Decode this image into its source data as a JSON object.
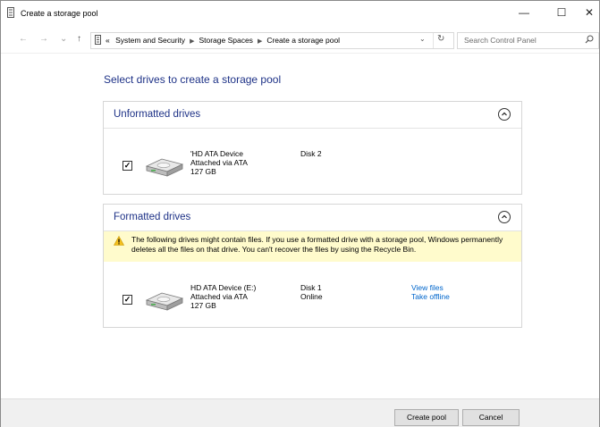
{
  "window": {
    "title": "Create a storage pool"
  },
  "titlebar": {
    "minimize": "—",
    "maximize": "☐",
    "close": "✕"
  },
  "nav": {
    "back": "←",
    "forward": "→",
    "recent": "⌄",
    "up": "↑",
    "breadcrumb": {
      "prefix": "«",
      "items": [
        "System and Security",
        "Storage Spaces",
        "Create a storage pool"
      ]
    },
    "dropdown": "⌄",
    "refresh": "↻"
  },
  "search": {
    "placeholder": "Search Control Panel"
  },
  "page": {
    "heading": "Select drives to create a storage pool"
  },
  "unformatted": {
    "title": "Unformatted drives",
    "drives": [
      {
        "name": "'HD ATA Device",
        "attached": "Attached via ATA",
        "size": "127 GB",
        "disk": "Disk 2",
        "checked": true
      }
    ]
  },
  "formatted": {
    "title": "Formatted drives",
    "warning": "The following drives might contain files. If you use a formatted drive with a storage pool, Windows permanently deletes all the files on that drive. You can't recover the files by using the Recycle Bin.",
    "drives": [
      {
        "name": "HD ATA Device (E:)",
        "attached": "Attached via ATA",
        "size": "127 GB",
        "disk": "Disk 1",
        "status": "Online",
        "link1": "View files",
        "link2": "Take offline",
        "checked": true
      }
    ]
  },
  "footer": {
    "create": "Create pool",
    "cancel": "Cancel"
  },
  "colors": {
    "heading": "#1e3287",
    "link": "#0066cc",
    "warning_bg": "#fffbcc"
  },
  "icons": [
    "control-panel-icon",
    "back-icon",
    "forward-icon",
    "up-icon",
    "search-icon",
    "chevron-up-circle-icon",
    "warning-icon",
    "hard-drive-icon",
    "checkbox-checked-icon"
  ]
}
